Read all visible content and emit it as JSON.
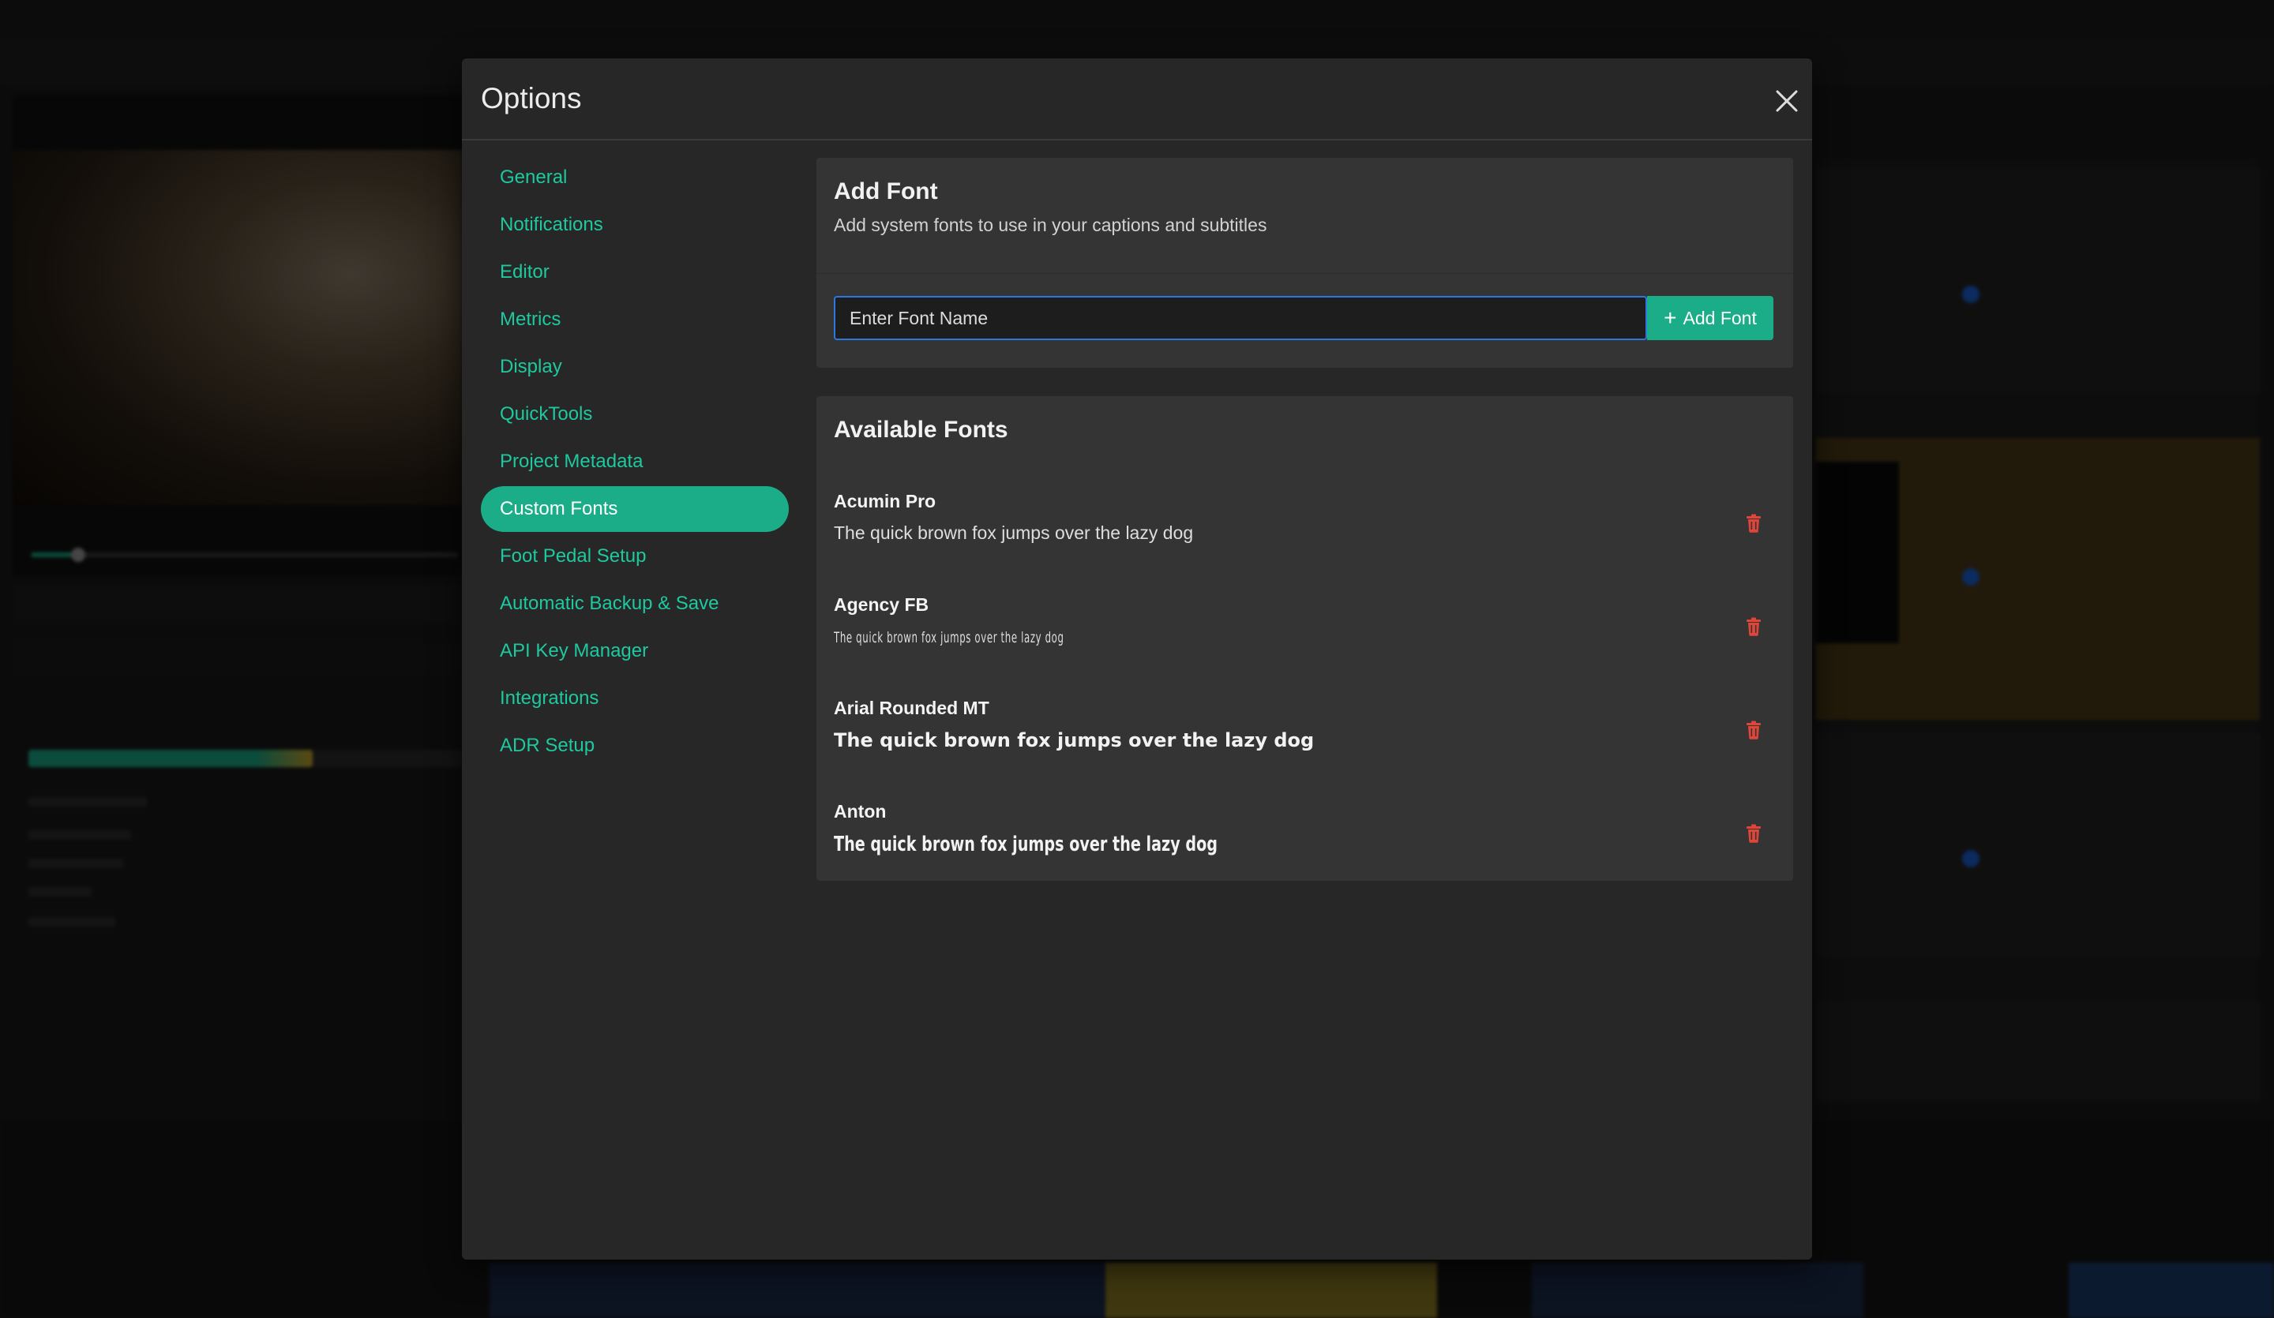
{
  "modal": {
    "title": "Options"
  },
  "sidebar": {
    "items": [
      {
        "label": "General",
        "active": false
      },
      {
        "label": "Notifications",
        "active": false
      },
      {
        "label": "Editor",
        "active": false
      },
      {
        "label": "Metrics",
        "active": false
      },
      {
        "label": "Display",
        "active": false
      },
      {
        "label": "QuickTools",
        "active": false
      },
      {
        "label": "Project Metadata",
        "active": false
      },
      {
        "label": "Custom Fonts",
        "active": true
      },
      {
        "label": "Foot Pedal Setup",
        "active": false
      },
      {
        "label": "Automatic Backup & Save",
        "active": false
      },
      {
        "label": "API Key Manager",
        "active": false
      },
      {
        "label": "Integrations",
        "active": false
      },
      {
        "label": "ADR Setup",
        "active": false
      }
    ]
  },
  "add_font": {
    "title": "Add Font",
    "subtitle": "Add system fonts to use in your captions and subtitles",
    "input_placeholder": "Enter Font Name",
    "input_value": "",
    "button_label": "Add Font",
    "button_icon": "plus-icon"
  },
  "available_fonts": {
    "title": "Available Fonts",
    "fonts": [
      {
        "name": "Acumin Pro",
        "sample": "The quick brown fox jumps over the lazy dog"
      },
      {
        "name": "Agency FB",
        "sample": "The quick brown fox jumps over the lazy dog"
      },
      {
        "name": "Arial Rounded MT",
        "sample": "The quick brown fox jumps over the lazy dog"
      },
      {
        "name": "Anton",
        "sample": "The quick brown fox jumps over the lazy dog"
      }
    ],
    "delete_icon": "trash-icon"
  },
  "colors": {
    "accent": "#1aad87",
    "accent_text": "#1ec9a0",
    "danger": "#e0453a",
    "modal_bg": "#272727",
    "card_bg": "#343434",
    "input_border": "#2e76e0"
  }
}
